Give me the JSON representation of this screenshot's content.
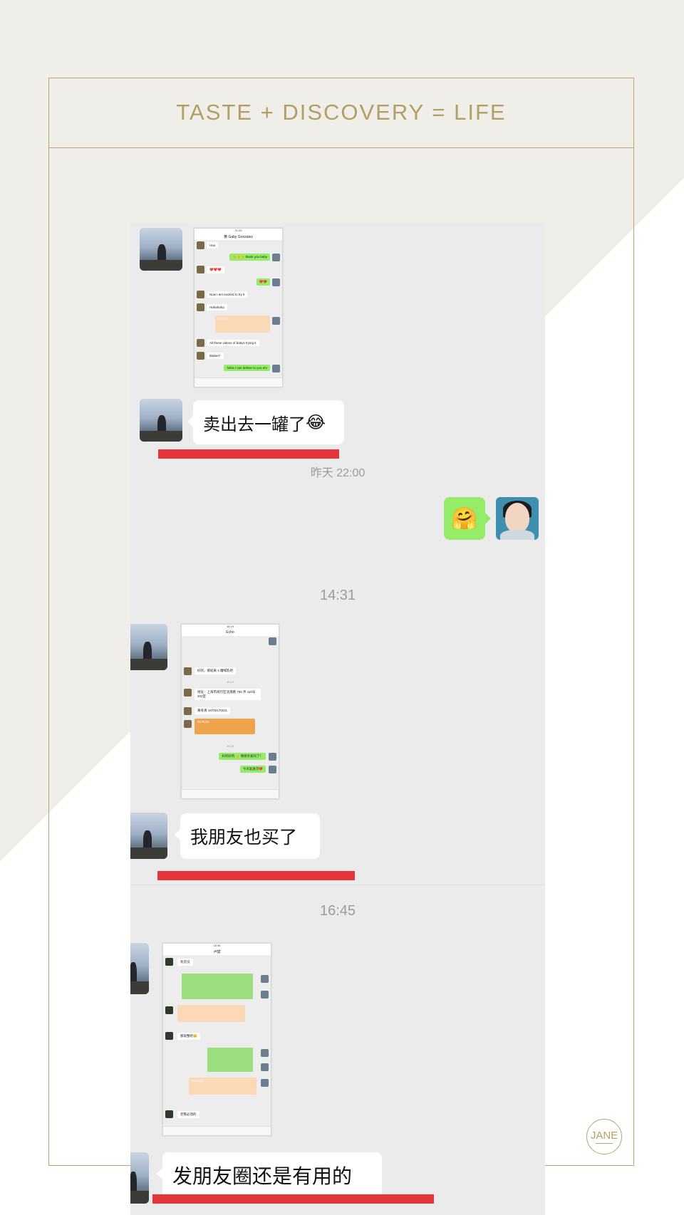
{
  "header": {
    "title": "TASTE + DISCOVERY = LIFE"
  },
  "logo": {
    "text": "JANE"
  },
  "colors": {
    "gold": "#b39f66",
    "chat_bg": "#ebebeb",
    "wechat_green": "#95ec69",
    "highlight_red": "#e4363a"
  },
  "chat": {
    "messages": [
      {
        "type": "image",
        "from": "contact",
        "content": "screenshot-chat-gaby"
      },
      {
        "type": "text",
        "from": "contact",
        "text": "卖出去一罐了",
        "emoji": "😂",
        "underlined": true
      },
      {
        "type": "time",
        "text": "昨天 22:00"
      },
      {
        "type": "text",
        "from": "me",
        "emoji": "🤗"
      },
      {
        "type": "time",
        "text": "14:31"
      },
      {
        "type": "image",
        "from": "contact",
        "content": "screenshot-chat-echo"
      },
      {
        "type": "text",
        "from": "contact",
        "text": "我朋友也买了",
        "underlined": true
      },
      {
        "type": "time",
        "text": "16:45"
      },
      {
        "type": "image",
        "from": "contact",
        "content": "screenshot-chat-lu"
      },
      {
        "type": "text",
        "from": "contact",
        "text": "发朋友圈还是有用的",
        "underlined": true
      }
    ]
  },
  "mini1": {
    "title": "黄 Gaby Gonzalez",
    "msgs": [
      "Hao",
      "👍👍👍 thank you baby",
      "❤️❤️❤️",
      "❤️❤️",
      "Now I am excited to try it",
      "Hahahaha",
      "¥22.00",
      "All these videos of babys trying it",
      "Babies*",
      "haha I can deliver to you nm"
    ]
  },
  "mini2": {
    "title": "Echo",
    "msgs": [
      "好的，那就来 4 罐哺乳吧",
      "16:13",
      "地址：上海市闵行区沈澳路 755 弄 110号 402室",
      "黄冬清 18702170211",
      "¥176.00",
      "16:18",
      "好的好的 👍 谢谢亲爱的了！",
      "今天就发货❤️"
    ]
  },
  "mini3": {
    "title": "卢斌",
    "msgs": [
      "有货没",
      "那就整吧😊",
      "¥352.00",
      "老铁必须的"
    ]
  }
}
